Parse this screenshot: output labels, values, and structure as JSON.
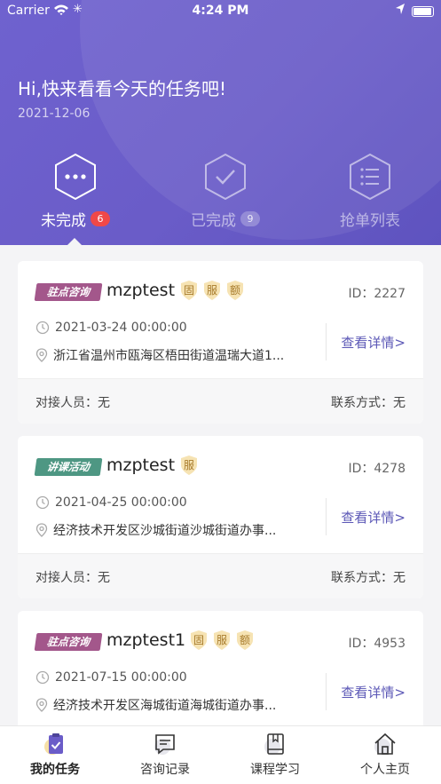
{
  "status_bar": {
    "carrier": "Carrier",
    "time": "4:24 PM"
  },
  "header": {
    "greeting": "Hi,快来看看今天的任务吧!",
    "date": "2021-12-06",
    "tabs": [
      {
        "label": "未完成",
        "count": "6",
        "active": true
      },
      {
        "label": "已完成",
        "count": "9",
        "active": false
      },
      {
        "label": "抢单列表",
        "count": "",
        "active": false
      }
    ]
  },
  "cards": [
    {
      "tag": "驻点咨询",
      "tag_color": "#a3578b",
      "name": "mzptest",
      "badges": [
        "固",
        "服",
        "额"
      ],
      "id": "ID：2227",
      "time": "2021-03-24 00:00:00",
      "address": "浙江省温州市瓯海区梧田街道温瑞大道1...",
      "detail": "查看详情>",
      "contact_person": "对接人员：无",
      "contact_method": "联系方式：无"
    },
    {
      "tag": "讲课活动",
      "tag_color": "#4e9783",
      "name": "mzptest",
      "badges": [
        "服"
      ],
      "id": "ID：4278",
      "time": "2021-04-25 00:00:00",
      "address": "经济技术开发区沙城街道沙城街道办事...",
      "detail": "查看详情>",
      "contact_person": "对接人员：无",
      "contact_method": "联系方式：无"
    },
    {
      "tag": "驻点咨询",
      "tag_color": "#a3578b",
      "name": "mzptest1",
      "badges": [
        "固",
        "服",
        "额"
      ],
      "id": "ID：4953",
      "time": "2021-07-15 00:00:00",
      "address": "经济技术开发区海城街道海城街道办事...",
      "detail": "查看详情>",
      "contact_person": "",
      "contact_method": ""
    }
  ],
  "bottom_nav": [
    {
      "label": "我的任务",
      "icon": "clipboard-icon",
      "active": true
    },
    {
      "label": "咨询记录",
      "icon": "chat-icon",
      "active": false
    },
    {
      "label": "课程学习",
      "icon": "book-icon",
      "active": false
    },
    {
      "label": "个人主页",
      "icon": "home-icon",
      "active": false
    }
  ]
}
